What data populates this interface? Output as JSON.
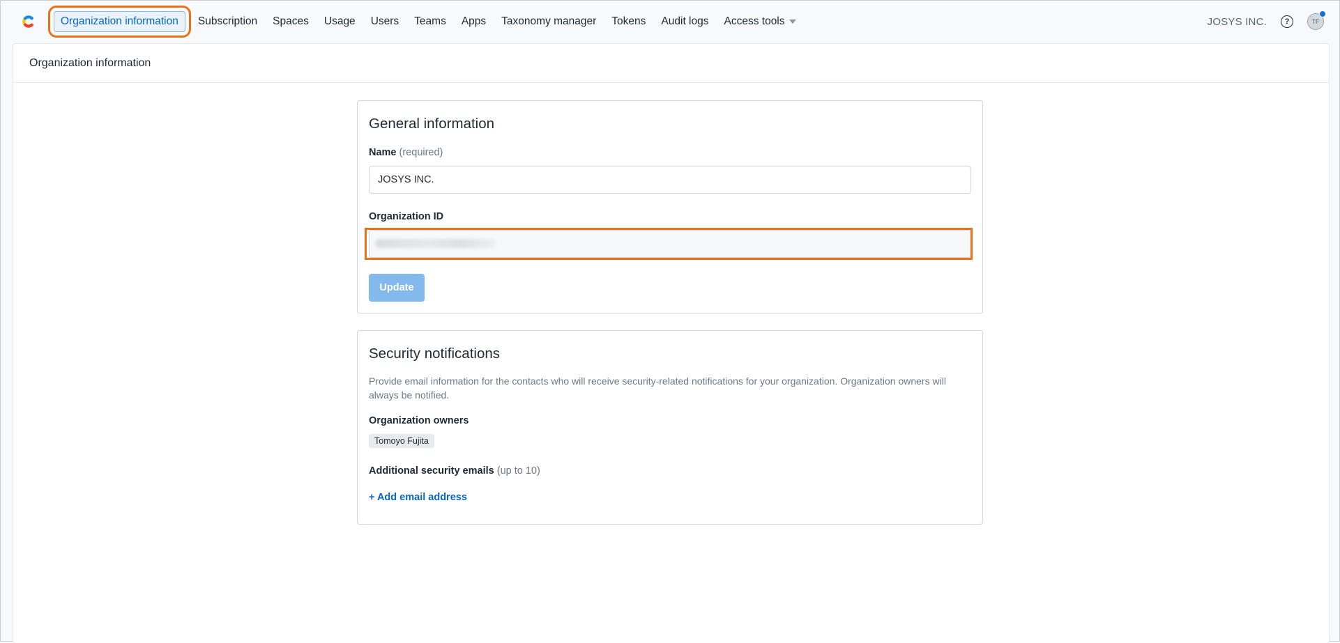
{
  "nav": {
    "items": [
      {
        "label": "Organization information",
        "active": true
      },
      {
        "label": "Subscription"
      },
      {
        "label": "Spaces"
      },
      {
        "label": "Usage"
      },
      {
        "label": "Users"
      },
      {
        "label": "Teams"
      },
      {
        "label": "Apps"
      },
      {
        "label": "Taxonomy manager"
      },
      {
        "label": "Tokens"
      },
      {
        "label": "Audit logs"
      },
      {
        "label": "Access tools",
        "dropdown": true
      }
    ],
    "org_name": "JOSYS INC.",
    "help_icon": "?",
    "avatar_initials": "TF"
  },
  "page": {
    "title": "Organization information"
  },
  "general": {
    "heading": "General information",
    "name_label": "Name",
    "name_hint": "(required)",
    "name_value": "JOSYS INC.",
    "org_id_label": "Organization ID",
    "update_label": "Update"
  },
  "security": {
    "heading": "Security notifications",
    "description": "Provide email information for the contacts who will receive security-related notifications for your organization. Organization owners will always be notified.",
    "owners_label": "Organization owners",
    "owners": [
      "Tomoyo Fujita"
    ],
    "additional_label": "Additional security emails",
    "additional_hint": "(up to 10)",
    "add_link": "+ Add email address"
  },
  "colors": {
    "accent": "#0a66c2",
    "highlight": "#e8711c",
    "button_disabled": "#84b9ee"
  }
}
